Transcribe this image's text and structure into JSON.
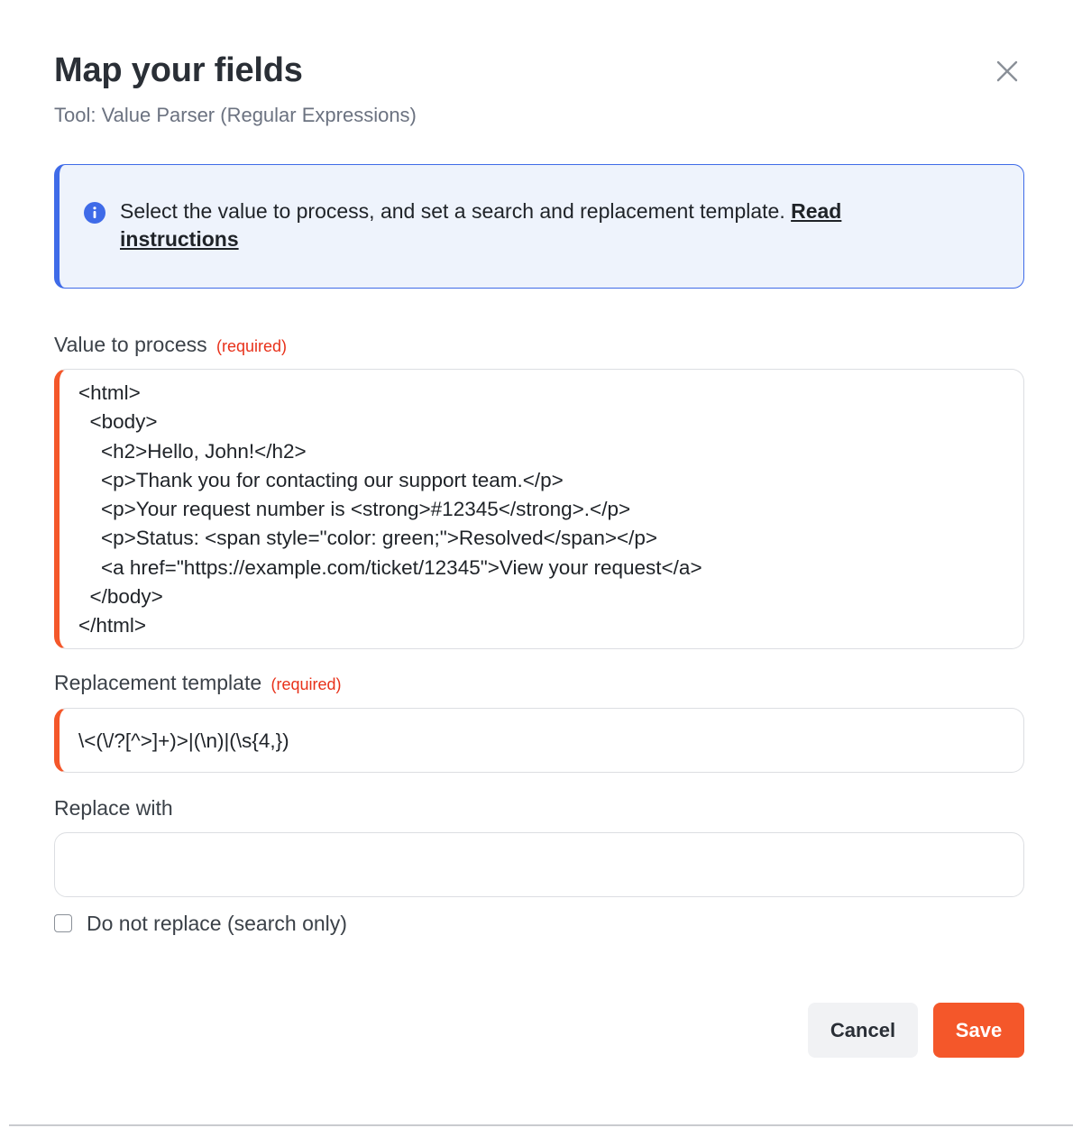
{
  "dialog": {
    "title": "Map your fields",
    "subtitle": "Tool: Value Parser (Regular Expressions)"
  },
  "info": {
    "text": "Select the value to process, and set a search and replacement template. ",
    "link_label": "Read instructions"
  },
  "fields": {
    "value": {
      "label": "Value to process",
      "required_tag": "(required)",
      "content": "<html>\n  <body>\n    <h2>Hello, John!</h2>\n    <p>Thank you for contacting our support team.</p>\n    <p>Your request number is <strong>#12345</strong>.</p>\n    <p>Status: <span style=\"color: green;\">Resolved</span></p>\n    <a href=\"https://example.com/ticket/12345\">View your request</a>\n  </body>\n</html>"
    },
    "template": {
      "label": "Replacement template",
      "required_tag": "(required)",
      "value": "\\<(\\/?[^>]+)>|(\\n)|(\\s{4,})"
    },
    "replace": {
      "label": "Replace with",
      "value": ""
    },
    "search_only": {
      "label": "Do not replace (search only)",
      "checked": false
    }
  },
  "actions": {
    "cancel_label": "Cancel",
    "save_label": "Save"
  },
  "colors": {
    "accent": "#f4572a",
    "info": "#3f6be8",
    "info_bg": "#eef3fc",
    "required": "#e8311a"
  },
  "icons": {
    "close": "close-icon",
    "info": "info-icon"
  }
}
